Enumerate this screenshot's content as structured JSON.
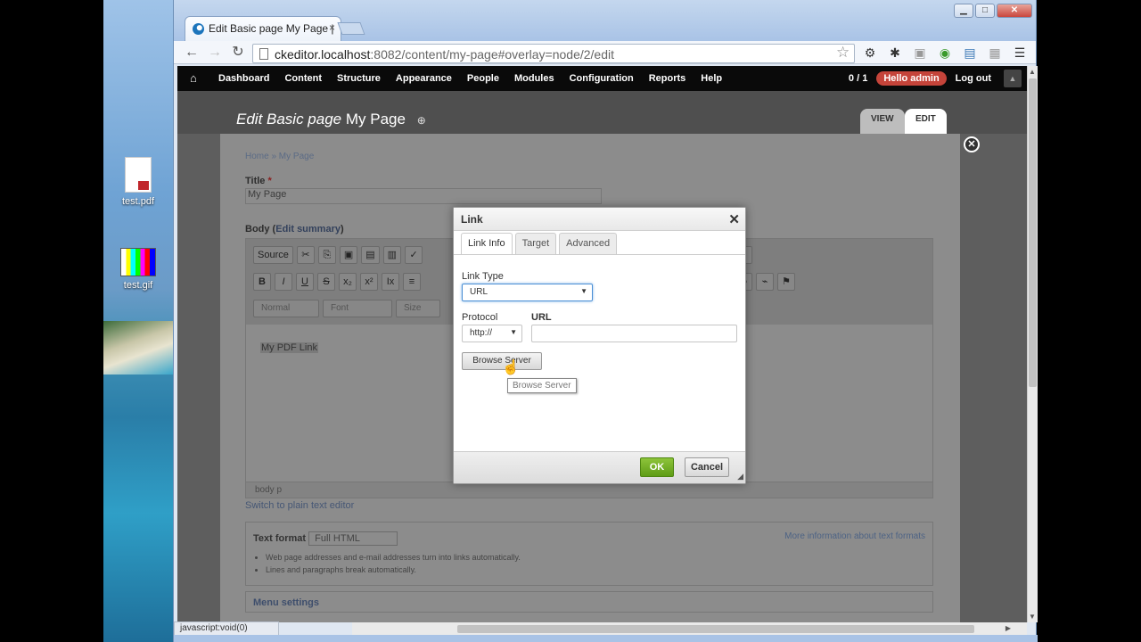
{
  "desktop": {
    "icons": [
      {
        "label": "test.pdf"
      },
      {
        "label": "test.gif"
      }
    ]
  },
  "browser": {
    "tab_title": "Edit Basic page My Page |",
    "tab_close": "×",
    "url_host": "ckeditor.localhost",
    "url_path": ":8082/content/my-page#overlay=node/2/edit",
    "status_text": "javascript:void(0)"
  },
  "admin_bar": {
    "menu": [
      "Dashboard",
      "Content",
      "Structure",
      "Appearance",
      "People",
      "Modules",
      "Configuration",
      "Reports",
      "Help"
    ],
    "counter": "0 / 1",
    "hello": "Hello admin",
    "logout": "Log out"
  },
  "page": {
    "title_prefix": "Edit Basic page",
    "title_name": "My Page",
    "tab_view": "VIEW",
    "tab_edit": "EDIT",
    "breadcrumb": "Home » My Page",
    "title_label": "Title",
    "title_required": "*",
    "title_value": "My Page",
    "body_label": "Body",
    "edit_summary": "Edit summary",
    "editor_source": "Source",
    "combo_format": "Normal",
    "combo_font": "Font",
    "combo_size": "Size",
    "body_content": "My PDF Link",
    "editor_path": "body   p",
    "plain_text_link": "Switch to plain text editor",
    "text_format_label": "Text format",
    "text_format_value": "Full HTML",
    "more_info": "More information about text formats",
    "tips": [
      "Web page addresses and e-mail addresses turn into links automatically.",
      "Lines and paragraphs break automatically."
    ],
    "menu_settings": "Menu settings"
  },
  "dialog": {
    "title": "Link",
    "tabs": [
      "Link Info",
      "Target",
      "Advanced"
    ],
    "link_type_label": "Link Type",
    "link_type_value": "URL",
    "protocol_label": "Protocol",
    "protocol_value": "http://",
    "url_label": "URL",
    "url_value": "",
    "browse_button": "Browse Server",
    "tooltip": "Browse Server",
    "ok": "OK",
    "cancel": "Cancel"
  },
  "colors": {
    "accent_green": "#6aa820",
    "hello_red": "#c5443a"
  }
}
